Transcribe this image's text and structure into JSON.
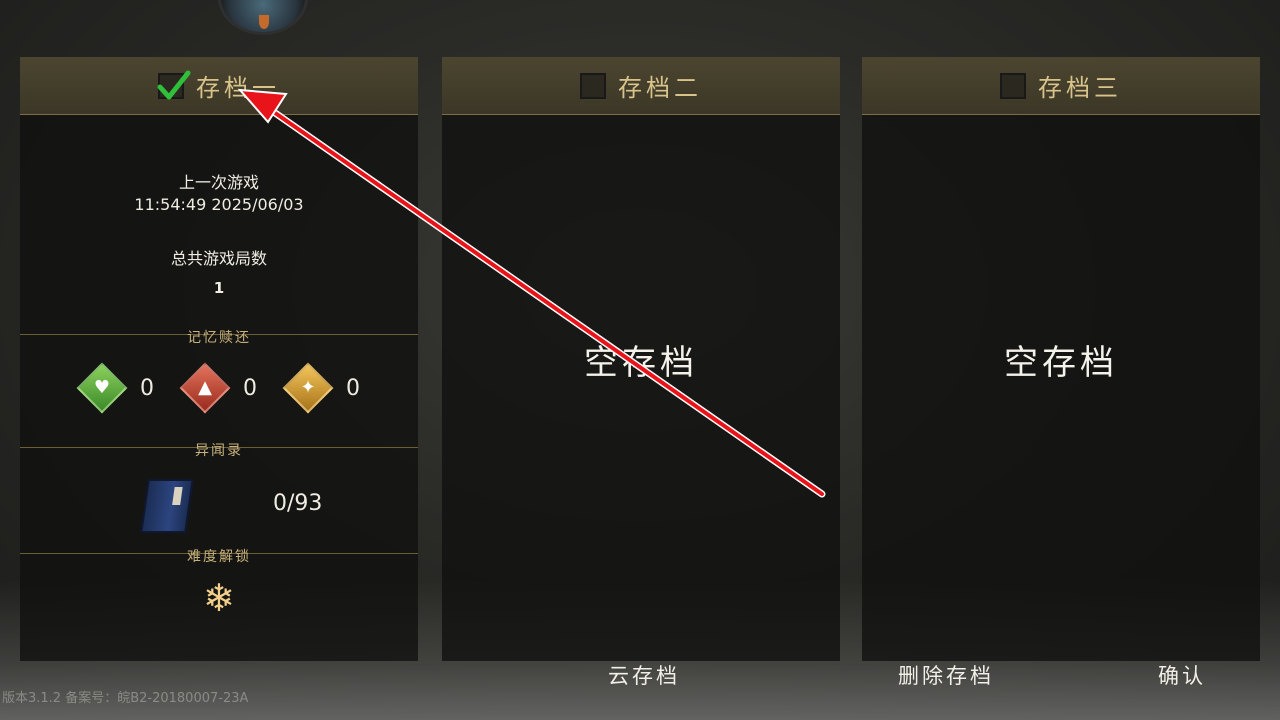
{
  "slots": [
    {
      "title": "存档一",
      "checked": true,
      "last_played_label": "上一次游戏",
      "last_played_value": "11:54:49 2025/06/03",
      "total_games_label": "总共游戏局数",
      "total_games_value": "1",
      "memory_section_title": "记忆赎还",
      "memory_items": [
        {
          "icon": "green-heart-gem-icon",
          "color": "#5fae3a",
          "count": "0"
        },
        {
          "icon": "red-blade-gem-icon",
          "color": "#c2412e",
          "count": "0"
        },
        {
          "icon": "gold-rune-gem-icon",
          "color": "#d49a2a",
          "count": "0"
        }
      ],
      "compendium_section_title": "异闻录",
      "compendium_icon": "book-icon",
      "compendium_value": "0/93",
      "difficulty_section_title": "难度解锁",
      "difficulty_icon": "snowflake-icon"
    },
    {
      "title": "存档二",
      "checked": false,
      "empty_text": "空存档"
    },
    {
      "title": "存档三",
      "checked": false,
      "empty_text": "空存档"
    }
  ],
  "buttons": {
    "cloud_save": "云存档",
    "delete_save": "删除存档",
    "confirm": "确认"
  },
  "version_text": "版本3.1.2   备案号：皖B2-20180007-23A",
  "colors": {
    "header_gold": "#d8c38a",
    "check_green": "#2fbf3a",
    "annotation_red": "#e8141a"
  }
}
